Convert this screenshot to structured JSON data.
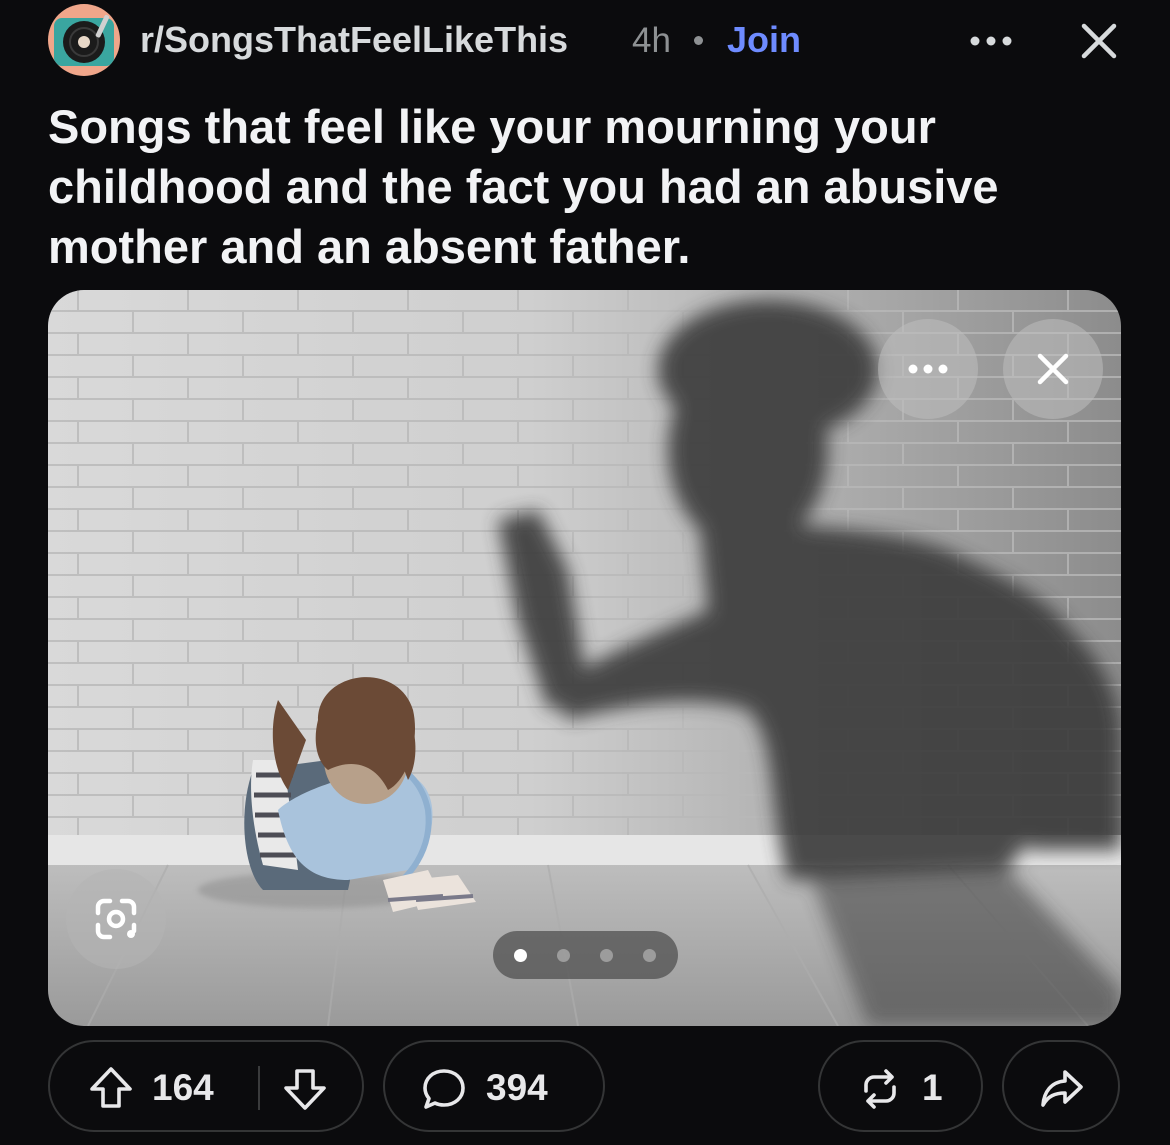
{
  "header": {
    "subreddit": "r/SongsThatFeelLikeThis",
    "time_ago": "4h",
    "join_label": "Join",
    "more_icon": "ellipsis-icon",
    "close_icon": "close-icon"
  },
  "post": {
    "title": "Songs that feel like your mourning your childhood and the fact you had an abusive mother and an absent father."
  },
  "media": {
    "gallery_current": 1,
    "gallery_total": 4,
    "icons": [
      "ellipsis-icon",
      "close-icon",
      "google-lens-icon"
    ]
  },
  "actions": {
    "upvotes": "164",
    "comments": "394",
    "reposts": "1",
    "icons": [
      "upvote-arrow-icon",
      "downvote-arrow-icon",
      "comment-bubble-icon",
      "repost-icon",
      "share-icon"
    ]
  },
  "colors": {
    "background": "#0b0b0d",
    "join_accent": "#6e8bff",
    "pill_border": "#343536",
    "text": "#e8e8ea",
    "muted": "#8e9193"
  }
}
